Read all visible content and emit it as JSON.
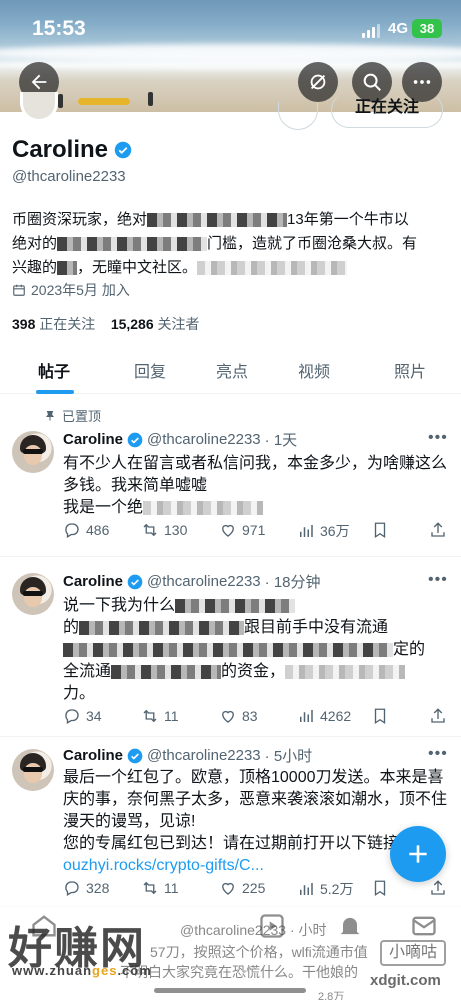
{
  "status_bar": {
    "time": "15:53",
    "network": "4G",
    "battery": "38"
  },
  "header": {
    "follow_button_label": "正在关注"
  },
  "profile": {
    "name": "Caroline",
    "handle": "@thcaroline2233",
    "bio_line1_a": "币圈资深玩家，绝对",
    "bio_line1_b": "13年第一个牛市以",
    "bio_line2_a": "绝对的",
    "bio_line2_b": "门槛，造就了币圈沧桑大叔。有",
    "bio_line3_a": "兴趣的",
    "bio_line3_b": "，无瞳中文社区。",
    "joined": "2023年5月 加入",
    "following_count": "398",
    "following_label": "正在关注",
    "followers_count": "15,286",
    "followers_label": "关注者"
  },
  "tabs": [
    {
      "label": "帖子"
    },
    {
      "label": "回复"
    },
    {
      "label": "亮点"
    },
    {
      "label": "视频"
    },
    {
      "label": "照片"
    }
  ],
  "pinned_label": "已置顶",
  "tweets": [
    {
      "name": "Caroline",
      "handle": "@thcaroline2233",
      "time": "· 1天",
      "body_1": "有不少人在留言或者私信问我，本金多少，为啥赚这么多钱。我来简单嘘嘘",
      "body_2": "我是一个绝",
      "replies": "486",
      "retweets": "130",
      "likes": "971",
      "views": "36万"
    },
    {
      "name": "Caroline",
      "handle": "@thcaroline2233",
      "time": "· 18分钟",
      "body_1": "说一下我为什么",
      "body_2a": "的",
      "body_2b": "跟目前手中没有流通",
      "body_2c": "定的",
      "body_3a": "全流通",
      "body_3b": "的资金，",
      "body_4": "力。",
      "replies": "34",
      "retweets": "11",
      "likes": "83",
      "views": "4262"
    },
    {
      "name": "Caroline",
      "handle": "@thcaroline2233",
      "time": "· 5小时",
      "body": "最后一个红包了。欧意，顶格10000刀发送。本来是喜庆的事，奈何黑子太多，恶意来袭滚滚如潮水，顶不住漫天的谩骂，见谅!",
      "body_red": "您的专属红包已到达！请在过期前打开以下链接领取：",
      "link": "ouzhyi.rocks/crypto-gifts/C...",
      "replies": "328",
      "retweets": "11",
      "likes": "225",
      "views": "5.2万"
    }
  ],
  "overlay": {
    "watermark_main": "好赚网",
    "watermark_url_a": "www.zhuan",
    "watermark_url_b": "ges",
    "watermark_url_c": ".com",
    "watermark2_box": "小嘀咕",
    "watermark2_url": "xdgit.com",
    "ghost_handle": "@thcaroline2233 · 小时",
    "ghost_line": "57刀，按照这个价格，wlfi流通市值",
    "ghost_line2": "不明白大家究竟在恐慌什么。干他娘的",
    "ghost_views": "2.8万"
  }
}
